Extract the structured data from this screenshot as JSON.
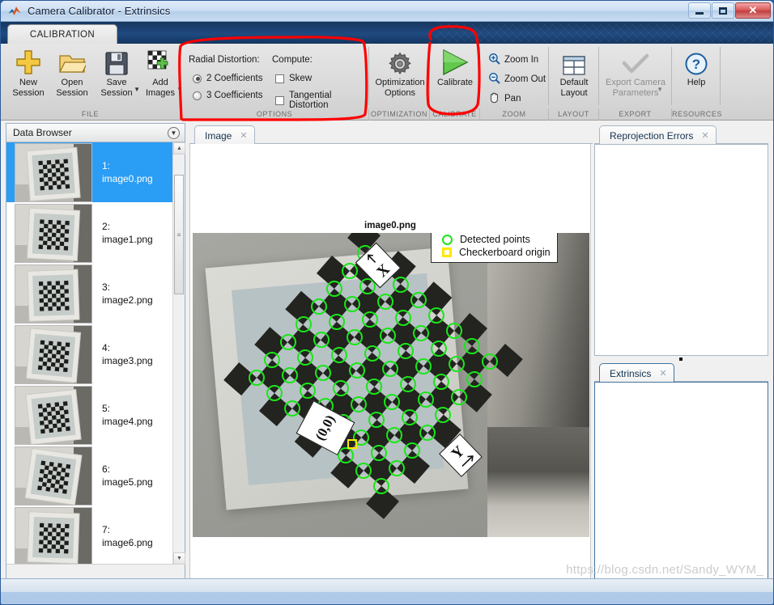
{
  "window": {
    "title": "Camera Calibrator - Extrinsics",
    "app_icon": "matlab-logo-icon",
    "minimize_label": "Minimize",
    "maximize_label": "Maximize",
    "close_label": "✕"
  },
  "quick_access": {
    "buttons": [
      {
        "name": "new-session-qat-icon",
        "glyph": "⇱",
        "enabled": true
      },
      {
        "name": "save-qat-icon",
        "glyph": "▤",
        "enabled": false
      },
      {
        "name": "cut-qat-icon",
        "glyph": "✂",
        "enabled": false
      },
      {
        "name": "copy-qat-icon",
        "glyph": "⧉",
        "enabled": false
      },
      {
        "name": "paste-qat-icon",
        "glyph": "📋",
        "enabled": false
      },
      {
        "name": "undo-qat-icon",
        "glyph": "↺",
        "enabled": false
      },
      {
        "name": "redo-qat-icon",
        "glyph": "↻",
        "enabled": false
      },
      {
        "name": "layout-qat-icon",
        "glyph": "❐",
        "enabled": true
      },
      {
        "name": "help-qat-icon",
        "glyph": "?",
        "enabled": true
      },
      {
        "name": "collapse-ribbon-icon",
        "glyph": "⤒",
        "enabled": true
      }
    ]
  },
  "ribbon": {
    "tab": "CALIBRATION",
    "groups": [
      {
        "id": "file",
        "label": "FILE"
      },
      {
        "id": "options",
        "label": "OPTIONS"
      },
      {
        "id": "optimization",
        "label": "OPTIMIZATION"
      },
      {
        "id": "calibrate",
        "label": "CALIBRATE"
      },
      {
        "id": "zoom",
        "label": "ZOOM"
      },
      {
        "id": "layout",
        "label": "LAYOUT"
      },
      {
        "id": "export",
        "label": "EXPORT"
      },
      {
        "id": "resources",
        "label": "RESOURCES"
      }
    ],
    "file": {
      "new_session": "New\nSession",
      "open_session": "Open\nSession",
      "save_session": "Save\nSession",
      "add_images": "Add\nImages"
    },
    "options": {
      "radial_distortion_label": "Radial Distortion:",
      "compute_label": "Compute:",
      "two_coefficients": "2 Coefficients",
      "three_coefficients": "3 Coefficients",
      "two_coefficients_selected": true,
      "three_coefficients_selected": false,
      "skew": "Skew",
      "skew_checked": false,
      "tangential_distortion": "Tangential Distortion",
      "tangential_distortion_checked": false
    },
    "optimization": {
      "label": "Optimization\nOptions",
      "icon": "gear-icon"
    },
    "calibrate": {
      "label": "Calibrate",
      "icon": "green-play-triangle-icon"
    },
    "zoom": {
      "zoom_in": "Zoom In",
      "zoom_out": "Zoom Out",
      "pan": "Pan"
    },
    "layout": {
      "default_layout": "Default\nLayout",
      "icon": "grid-layout-icon"
    },
    "export": {
      "export_camera_parameters": "Export Camera\nParameters",
      "icon": "checkmark-icon",
      "enabled": false
    },
    "resources": {
      "help": "Help",
      "icon": "help-circle-icon"
    }
  },
  "data_browser": {
    "title": "Data Browser",
    "collapse_icon": "chevron-down-icon",
    "items": [
      {
        "index": "1:",
        "file": "image0.png",
        "selected": true
      },
      {
        "index": "2:",
        "file": "image1.png",
        "selected": false
      },
      {
        "index": "3:",
        "file": "image2.png",
        "selected": false
      },
      {
        "index": "4:",
        "file": "image3.png",
        "selected": false
      },
      {
        "index": "5:",
        "file": "image4.png",
        "selected": false
      },
      {
        "index": "6:",
        "file": "image5.png",
        "selected": false
      },
      {
        "index": "7:",
        "file": "image6.png",
        "selected": false
      }
    ]
  },
  "image_panel": {
    "tab_label": "Image",
    "tab_close": "✕",
    "image_title": "image0.png",
    "legend": {
      "detected_points": "Detected points",
      "checkerboard_origin": "Checkerboard origin",
      "detected_points_color": "#19e619",
      "origin_color": "#ffe800"
    },
    "axis_labels": {
      "x": "X",
      "y": "Y",
      "origin": "(0,0)"
    }
  },
  "right_panels": {
    "reprojection_errors": {
      "tab_label": "Reprojection Errors",
      "tab_close": "✕"
    },
    "extrinsics": {
      "tab_label": "Extrinsics",
      "tab_close": "✕"
    }
  },
  "watermark": "https://blog.csdn.net/Sandy_WYM_",
  "annotations": {
    "color": "#fe0000",
    "regions": [
      "options-group-circled",
      "calibrate-button-circled"
    ]
  },
  "chart_data": {
    "type": "scatter",
    "title": "image0.png",
    "description": "Checkerboard calibration photo with detected corner points overlaid",
    "grid_rows": 8,
    "grid_cols": 8,
    "detected_point_count": 64,
    "origin_marker": "(0,0)",
    "axes": [
      "X",
      "Y"
    ],
    "legend": [
      "Detected points",
      "Checkerboard origin"
    ]
  }
}
